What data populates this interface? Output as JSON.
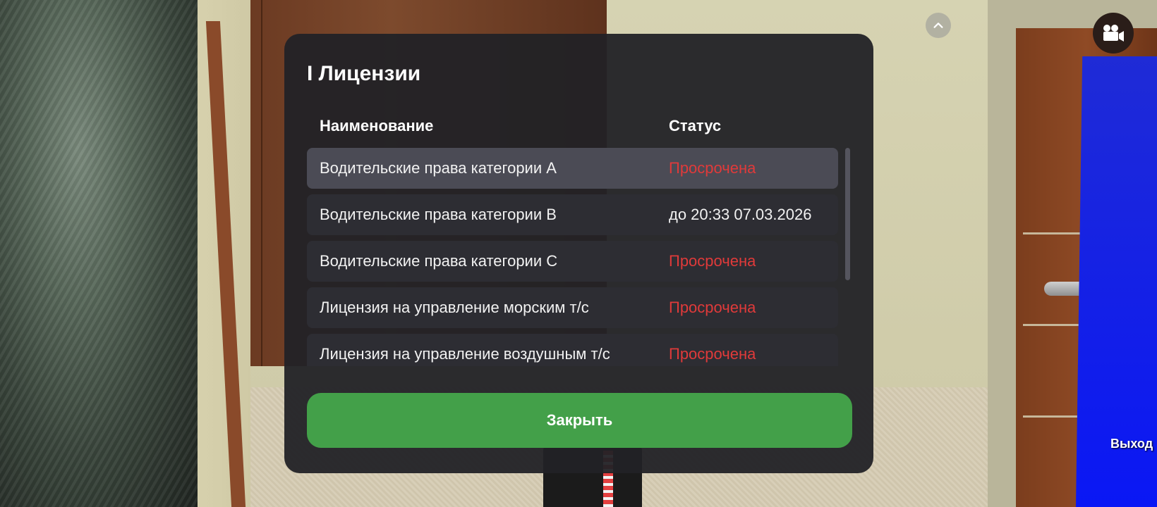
{
  "hud": {
    "collapse_icon": "chevron-up-icon",
    "camera_icon": "video-camera-icon",
    "exit_label": "Выход"
  },
  "modal": {
    "title": "I Лицензии",
    "columns": {
      "name": "Наименование",
      "status": "Статус"
    },
    "rows": [
      {
        "name": "Водительские права категории A",
        "status": "Просрочена",
        "state": "expired"
      },
      {
        "name": "Водительские права категории B",
        "status": "до 20:33 07.03.2026",
        "state": "valid"
      },
      {
        "name": "Водительские права категории C",
        "status": "Просрочена",
        "state": "expired"
      },
      {
        "name": "Лицензия на управление морским т/с",
        "status": "Просрочена",
        "state": "expired"
      },
      {
        "name": "Лицензия на управление воздушным т/с",
        "status": "Просрочена",
        "state": "expired"
      }
    ],
    "close_label": "Закрыть"
  },
  "colors": {
    "expired": "#e03a3a",
    "accent_button": "#43a049"
  }
}
